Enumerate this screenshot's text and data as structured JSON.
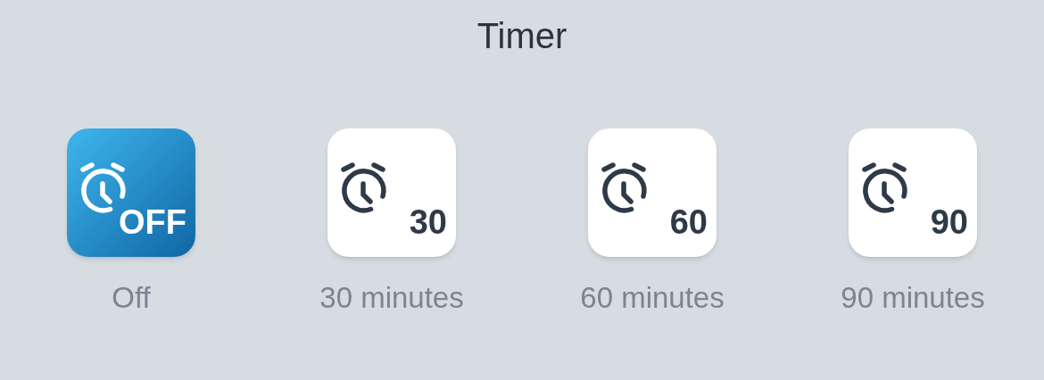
{
  "title": "Timer",
  "options": [
    {
      "label": "Off",
      "badge": "OFF",
      "selected": true
    },
    {
      "label": "30 minutes",
      "badge": "30",
      "selected": false
    },
    {
      "label": "60 minutes",
      "badge": "60",
      "selected": false
    },
    {
      "label": "90 minutes",
      "badge": "90",
      "selected": false
    }
  ]
}
